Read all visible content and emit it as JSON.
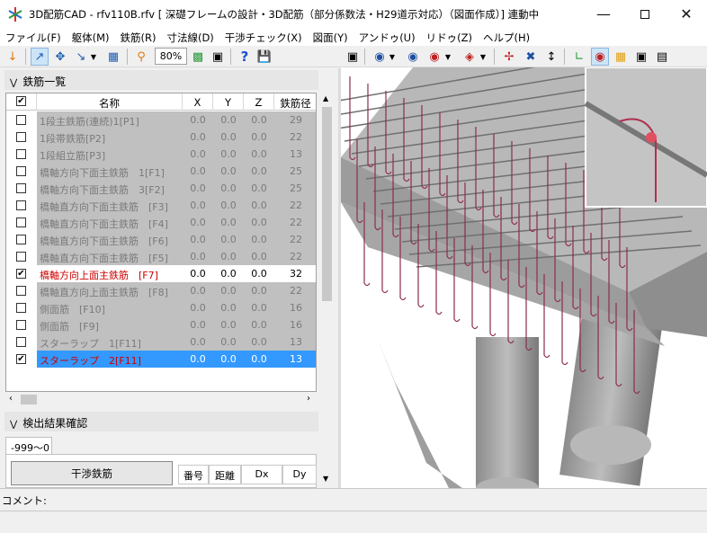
{
  "window": {
    "title": "3D配筋CAD - rfv110B.rfv [ 深礎フレームの設計・3D配筋（部分係数法・H29道示対応）（図面作成）] 連動中",
    "minimize_icon": "minimize-icon",
    "maximize_icon": "maximize-icon",
    "close_icon": "close-icon"
  },
  "menu": [
    "ファイル(F)",
    "躯体(M)",
    "鉄筋(R)",
    "寸法線(D)",
    "干渉チェック(X)",
    "図面(Y)",
    "アンドゥ(U)",
    "リドゥ(Z)",
    "ヘルプ(H)"
  ],
  "toolbar": {
    "zoom_value": "80%",
    "help_label": "?"
  },
  "rebar_list": {
    "section_title": "鉄筋一覧",
    "columns": [
      "名称",
      "X",
      "Y",
      "Z",
      "鉄筋径"
    ],
    "rows": [
      {
        "checked": false,
        "name": "1段主鉄筋(連続)1[P1]",
        "x": "0.0",
        "y": "0.0",
        "z": "0.0",
        "dia": "29",
        "state": "dim"
      },
      {
        "checked": false,
        "name": "1段帯鉄筋[P2]",
        "x": "0.0",
        "y": "0.0",
        "z": "0.0",
        "dia": "22",
        "state": "dim"
      },
      {
        "checked": false,
        "name": "1段組立筋[P3]",
        "x": "0.0",
        "y": "0.0",
        "z": "0.0",
        "dia": "13",
        "state": "dim"
      },
      {
        "checked": false,
        "name": "橋軸方向下面主鉄筋　1[F1]",
        "x": "0.0",
        "y": "0.0",
        "z": "0.0",
        "dia": "25",
        "state": "dim"
      },
      {
        "checked": false,
        "name": "橋軸方向下面主鉄筋　3[F2]",
        "x": "0.0",
        "y": "0.0",
        "z": "0.0",
        "dia": "25",
        "state": "dim"
      },
      {
        "checked": false,
        "name": "橋軸直方向下面主鉄筋　[F3]",
        "x": "0.0",
        "y": "0.0",
        "z": "0.0",
        "dia": "22",
        "state": "dim"
      },
      {
        "checked": false,
        "name": "橋軸直方向下面主鉄筋　[F4]",
        "x": "0.0",
        "y": "0.0",
        "z": "0.0",
        "dia": "22",
        "state": "dim"
      },
      {
        "checked": false,
        "name": "橋軸直方向下面主鉄筋　[F6]",
        "x": "0.0",
        "y": "0.0",
        "z": "0.0",
        "dia": "22",
        "state": "dim"
      },
      {
        "checked": false,
        "name": "橋軸直方向下面主鉄筋　[F5]",
        "x": "0.0",
        "y": "0.0",
        "z": "0.0",
        "dia": "22",
        "state": "dim"
      },
      {
        "checked": true,
        "name": "橋軸方向上面主鉄筋　[F7]",
        "x": "0.0",
        "y": "0.0",
        "z": "0.0",
        "dia": "32",
        "state": "active"
      },
      {
        "checked": false,
        "name": "橋軸直方向上面主鉄筋　[F8]",
        "x": "0.0",
        "y": "0.0",
        "z": "0.0",
        "dia": "22",
        "state": "dim"
      },
      {
        "checked": false,
        "name": "側面筋　[F10]",
        "x": "0.0",
        "y": "0.0",
        "z": "0.0",
        "dia": "16",
        "state": "dim"
      },
      {
        "checked": false,
        "name": "側面筋　[F9]",
        "x": "0.0",
        "y": "0.0",
        "z": "0.0",
        "dia": "16",
        "state": "dim"
      },
      {
        "checked": false,
        "name": "スターラップ　1[F11]",
        "x": "0.0",
        "y": "0.0",
        "z": "0.0",
        "dia": "13",
        "state": "dim"
      },
      {
        "checked": true,
        "name": "スターラップ　2[F11]",
        "x": "0.0",
        "y": "0.0",
        "z": "0.0",
        "dia": "13",
        "state": "selected"
      }
    ]
  },
  "detection": {
    "section_title": "検出結果確認",
    "tab_label": "-999〜0",
    "interference_button": "干渉鉄筋",
    "columns": [
      "番号",
      "距離",
      "Dx",
      "Dy"
    ]
  },
  "comment_label": "コメント:",
  "colors": {
    "selected_row": "#3399ff",
    "dim_row": "#c0c0c0",
    "active_text": "#cc0000",
    "rebar": "#8b2d4a",
    "concrete": "#a8a8a8"
  }
}
